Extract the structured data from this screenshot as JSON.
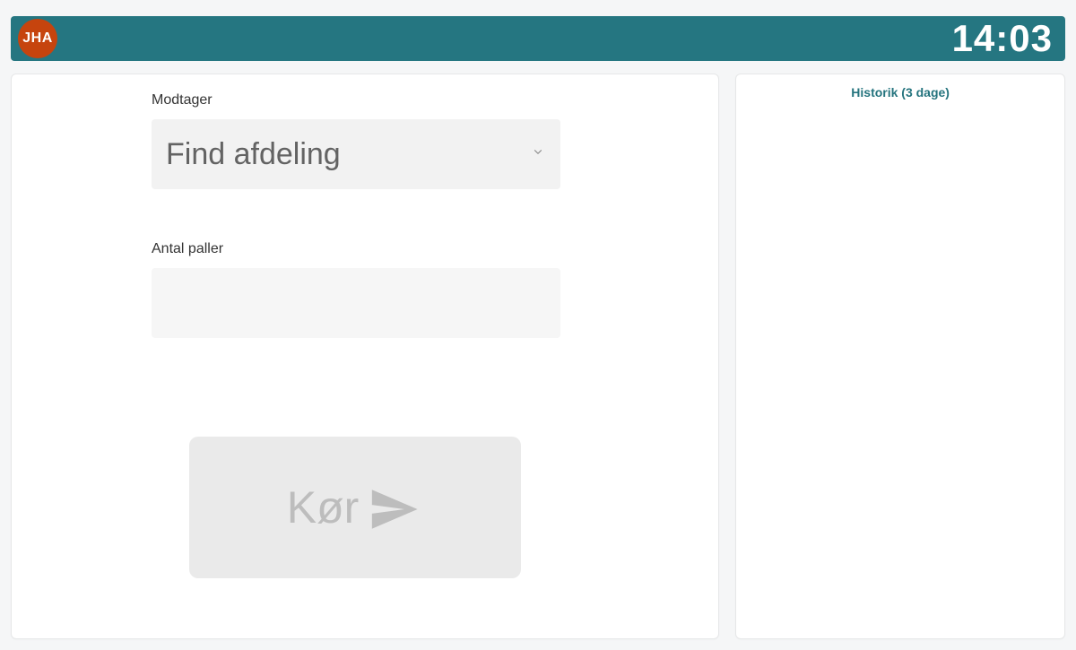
{
  "header": {
    "user_initials": "JHA",
    "clock": "14:03"
  },
  "form": {
    "recipient_label": "Modtager",
    "recipient_placeholder": "Find afdeling",
    "pallets_label": "Antal paller",
    "pallets_value": "",
    "run_button_label": "Kør"
  },
  "sidebar": {
    "history_title": "Historik (3 dage)"
  },
  "icons": {
    "chevron": "chevron-down-icon",
    "send": "paper-plane-icon"
  },
  "colors": {
    "brand_bar": "#257681",
    "avatar_bg": "#C6440E",
    "disabled_text": "#bdbdbd"
  }
}
